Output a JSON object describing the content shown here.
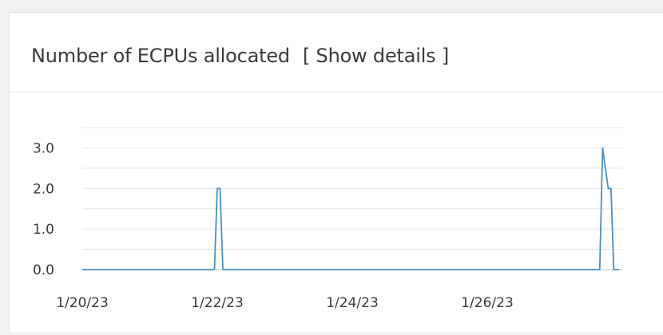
{
  "panel": {
    "title": "Number of ECPUs allocated",
    "details_link": "[ Show details ]"
  },
  "colors": {
    "line": "#4a90c2",
    "grid": "#e6e6e6",
    "axis": "#c8c8c8"
  },
  "chart_data": {
    "type": "line",
    "title": "Number of ECPUs allocated",
    "xlabel": "",
    "ylabel": "",
    "x_start": "1/20/23",
    "x_end": "1/28/23",
    "x_ticks": [
      "1/20/23",
      "1/22/23",
      "1/24/23",
      "1/26/23"
    ],
    "y_ticks": [
      "0.0",
      "1.0",
      "2.0",
      "3.0"
    ],
    "ylim": [
      0,
      3.5
    ],
    "grid": true,
    "series": [
      {
        "points": [
          [
            "1/20/23 00:00",
            0
          ],
          [
            "1/21/23 23:00",
            0
          ],
          [
            "1/22/23 00:00",
            2
          ],
          [
            "1/22/23 01:00",
            2
          ],
          [
            "1/22/23 02:00",
            0
          ],
          [
            "1/27/23 16:00",
            0
          ],
          [
            "1/27/23 17:00",
            3
          ],
          [
            "1/27/23 19:00",
            2
          ],
          [
            "1/27/23 20:00",
            2
          ],
          [
            "1/27/23 21:00",
            0
          ],
          [
            "1/27/23 23:00",
            0
          ]
        ]
      }
    ]
  }
}
